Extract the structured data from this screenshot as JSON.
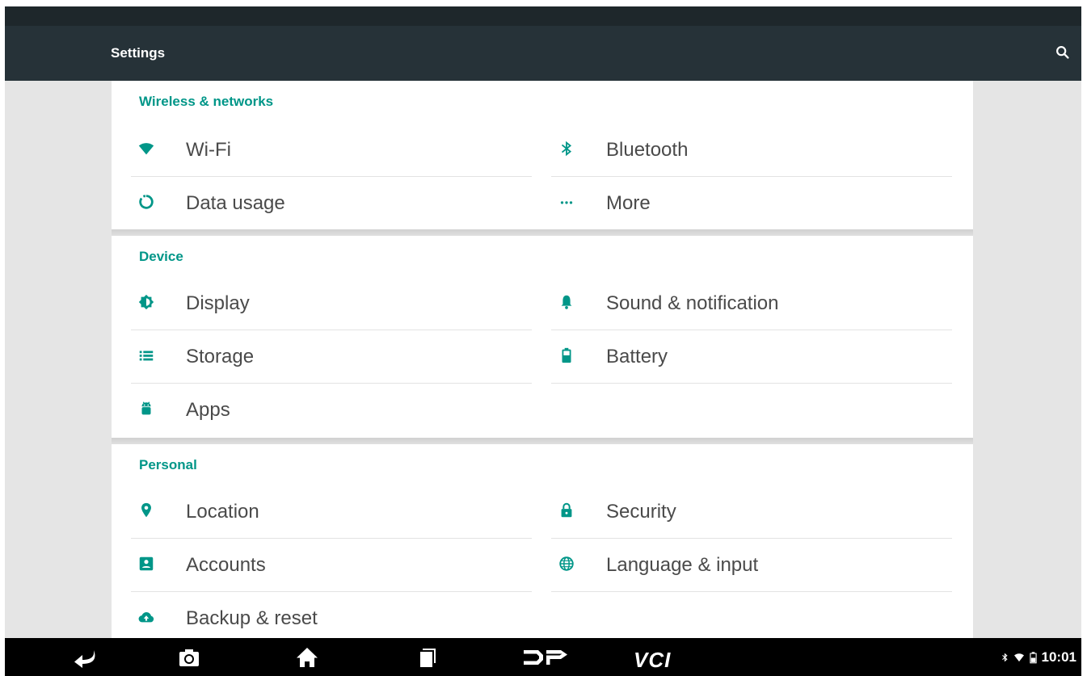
{
  "app": {
    "title": "Settings"
  },
  "colors": {
    "accent": "#009688",
    "toolbar": "#263238",
    "status_bar": "#1e272b",
    "nav_bar": "#000000",
    "background": "#e5e5e5",
    "card": "#ffffff"
  },
  "toolbar": {
    "search_icon": "search-icon"
  },
  "sections": [
    {
      "title": "Wireless & networks",
      "items": [
        {
          "label": "Wi-Fi",
          "icon": "wifi-icon"
        },
        {
          "label": "Bluetooth",
          "icon": "bluetooth-icon"
        },
        {
          "label": "Data usage",
          "icon": "data-usage-icon"
        },
        {
          "label": "More",
          "icon": "more-icon"
        }
      ]
    },
    {
      "title": "Device",
      "items": [
        {
          "label": "Display",
          "icon": "brightness-icon"
        },
        {
          "label": "Sound & notification",
          "icon": "bell-icon"
        },
        {
          "label": "Storage",
          "icon": "storage-icon"
        },
        {
          "label": "Battery",
          "icon": "battery-icon"
        },
        {
          "label": "Apps",
          "icon": "android-icon"
        }
      ]
    },
    {
      "title": "Personal",
      "items": [
        {
          "label": "Location",
          "icon": "location-pin-icon"
        },
        {
          "label": "Security",
          "icon": "lock-icon"
        },
        {
          "label": "Accounts",
          "icon": "account-icon"
        },
        {
          "label": "Language & input",
          "icon": "globe-icon"
        },
        {
          "label": "Backup & reset",
          "icon": "cloud-upload-icon"
        }
      ]
    }
  ],
  "navbar": {
    "buttons": [
      "back-icon",
      "camera-icon",
      "home-icon",
      "recents-icon",
      "dp-logo-icon"
    ],
    "vci_label": "VCI",
    "status_icons": [
      "bluetooth-icon",
      "wifi-icon",
      "battery-icon"
    ],
    "time": "10:01"
  }
}
